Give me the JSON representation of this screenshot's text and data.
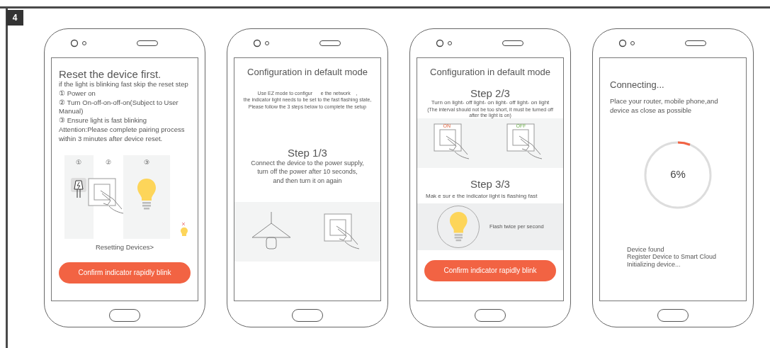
{
  "page_number": "4",
  "phones": [
    {
      "kind": "reset",
      "title": "Reset the device first.",
      "lines": [
        "if the light is blinking fast skip the reset step",
        "① Power on",
        "② Turn On-off-on-off-on(Subject to User Manual)",
        "③ Ensure light is fast blinking",
        "Attention:Please complete pairing process within 3 minutes after device reset."
      ],
      "step_labels": [
        "①",
        "②",
        "③"
      ],
      "caption": "Resetting Devices>",
      "button": "Confirm indicator rapidly blink"
    },
    {
      "kind": "step_one",
      "title": "Configuration in default mode",
      "intro": [
        "Use EZ mode to configur      e the network    ,",
        "the indicator light needs to be set to the fast flashing state,",
        "Please follow the 3 steps below to complete the setup"
      ],
      "step": "Step 1/3",
      "description": [
        "Connect the device to the power supply,",
        "turn off the power after 10 seconds,",
        "and then turn it on again"
      ]
    },
    {
      "kind": "steps_two_three",
      "title": "Configuration in default mode",
      "step": "Step 2/3",
      "description": "Turn on light- off light- on light- off light- on light",
      "note": "(The interval should not be too short, it must be turned off after the light is on)",
      "switch_labels": [
        "ON",
        "OFF"
      ],
      "step_next": "Step 3/3",
      "description_next": "Mak e sur e the indicator light is flashing fast",
      "flash_text": "Flash twice per second",
      "button": "Confirm indicator rapidly blink"
    },
    {
      "kind": "connecting",
      "title": "Connecting...",
      "description": "Place your router, mobile phone,and device as close as possible",
      "progress": {
        "level": 0.06,
        "label": "6%"
      },
      "status": [
        "Device found",
        "Register Device to Smart Cloud",
        "Initializing device..."
      ]
    }
  ]
}
